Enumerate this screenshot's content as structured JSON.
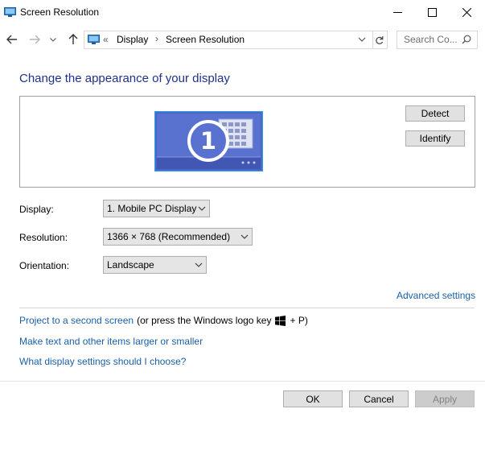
{
  "window": {
    "title": "Screen Resolution",
    "icon": "monitor-icon"
  },
  "caption_buttons": {
    "minimize": "—",
    "maximize": "☐",
    "close": "✕"
  },
  "address": {
    "overflow": "«",
    "crumbs": [
      "Display",
      "Screen Resolution"
    ],
    "separator": "›"
  },
  "search": {
    "placeholder": "Search Co..."
  },
  "main": {
    "title": "Change the appearance of your display",
    "monitor_number": "1",
    "detect_label": "Detect",
    "identify_label": "Identify"
  },
  "settings": {
    "display_label": "Display:",
    "display_value": "1. Mobile PC Display",
    "resolution_label": "Resolution:",
    "resolution_value": "1366 × 768 (Recommended)",
    "orientation_label": "Orientation:",
    "orientation_value": "Landscape"
  },
  "links": {
    "advanced": "Advanced settings",
    "project": "Project to a second screen",
    "project_hint_prefix": "(or press the Windows logo key",
    "project_hint_suffix": "+ P)",
    "text_size": "Make text and other items larger or smaller",
    "which_settings": "What display settings should I choose?"
  },
  "footer": {
    "ok_label": "OK",
    "cancel_label": "Cancel",
    "apply_label": "Apply"
  },
  "colors": {
    "title_blue": "#1e3287",
    "link_blue": "#1a5fa8",
    "monitor_blue": "#4b63c4"
  }
}
